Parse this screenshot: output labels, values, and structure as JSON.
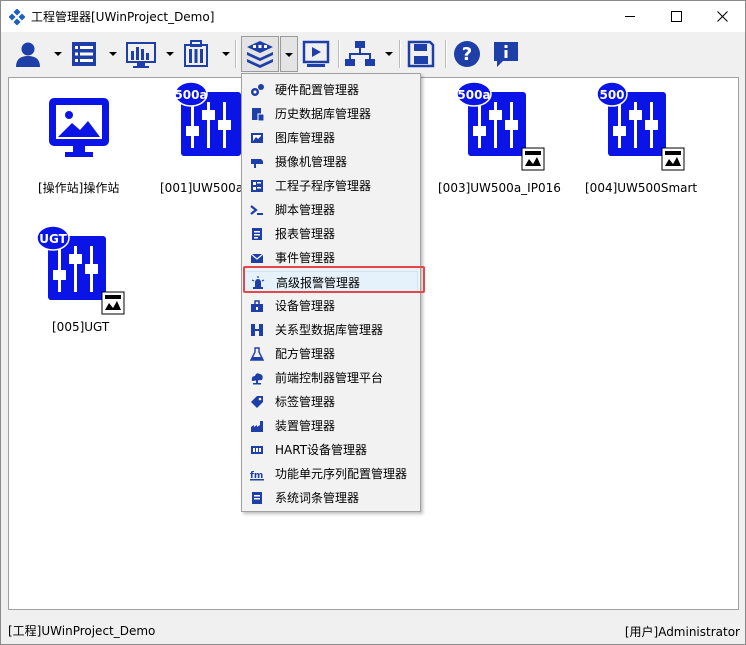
{
  "window": {
    "title": "工程管理器[UWinProject_Demo]"
  },
  "devices": [
    {
      "label": "[操作站]操作站"
    },
    {
      "label": "[001]UW500a_",
      "badge": "500a"
    },
    {
      "label": "[003]UW500a_IP016",
      "badge": "500a"
    },
    {
      "label": "[004]UW500Smart",
      "badge": "500"
    },
    {
      "label": "[005]UGT",
      "badge": "UGT"
    }
  ],
  "menu": {
    "items": [
      {
        "label": "硬件配置管理器",
        "icon": "hardware-config-icon"
      },
      {
        "label": "历史数据库管理器",
        "icon": "history-database-icon"
      },
      {
        "label": "图库管理器",
        "icon": "gallery-icon"
      },
      {
        "label": "摄像机管理器",
        "icon": "camera-icon"
      },
      {
        "label": "工程子程序管理器",
        "icon": "subprogram-icon"
      },
      {
        "label": "脚本管理器",
        "icon": "script-icon"
      },
      {
        "label": "报表管理器",
        "icon": "report-icon"
      },
      {
        "label": "事件管理器",
        "icon": "event-icon"
      },
      {
        "label": "高级报警管理器",
        "icon": "alarm-icon"
      },
      {
        "label": "设备管理器",
        "icon": "device-icon"
      },
      {
        "label": "关系型数据库管理器",
        "icon": "relational-database-icon"
      },
      {
        "label": "配方管理器",
        "icon": "recipe-icon"
      },
      {
        "label": "前端控制器管理平台",
        "icon": "controller-platform-icon"
      },
      {
        "label": "标签管理器",
        "icon": "tag-icon"
      },
      {
        "label": "装置管理器",
        "icon": "unit-icon"
      },
      {
        "label": "HART设备管理器",
        "icon": "hart-icon"
      },
      {
        "label": "功能单元序列配置管理器",
        "icon": "function-unit-icon"
      },
      {
        "label": "系统词条管理器",
        "icon": "dictionary-icon"
      }
    ],
    "highlighted_index": 8
  },
  "status": {
    "project": "[工程]UWinProject_Demo",
    "user": "[用户]Administrator"
  },
  "colors": {
    "device_blue": "#0a14e6",
    "highlight": "#e2484a",
    "icon_blue": "#1f3fa8"
  }
}
